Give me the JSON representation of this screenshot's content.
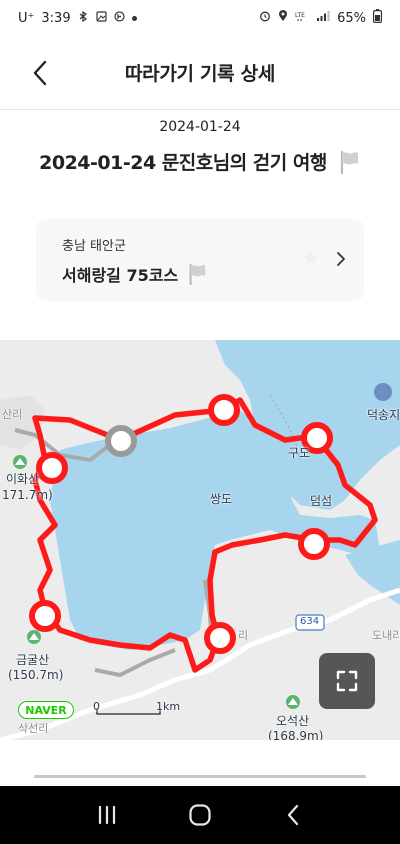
{
  "status_bar": {
    "carrier": "U⁺",
    "time": "3:39",
    "battery": "65%",
    "left_icons": [
      "bluetooth-icon",
      "image-icon",
      "app-icon"
    ],
    "right_icons": [
      "alarm-icon",
      "location-icon",
      "lte-icon",
      "signal-icon",
      "battery-icon"
    ]
  },
  "header": {
    "title": "따라가기 기록 상세"
  },
  "record": {
    "date": "2024-01-24",
    "title": "2024-01-24 문진호님의 걷기 여행"
  },
  "course": {
    "region": "충남 태안군",
    "name": "서해랑길 75코스"
  },
  "map": {
    "labels": {
      "sanri": "산리",
      "ihwasan": "이화산",
      "ihwasan_height": "171.7m)",
      "ssangdo": "쌍도",
      "gudo": "구도",
      "deomseom": "덤섬",
      "deoksong": "덕송지",
      "geumgulsan": "금굴산",
      "geumgulsan_height": "(150.7m)",
      "ri": "리",
      "donae": "도내리",
      "road": "634",
      "oseoksan": "오석산",
      "oseoksan_height": "(168.9m)",
      "sakseonri": "삭선리",
      "scale_zero": "0",
      "scale_km": "1km"
    },
    "logo": "NAVER",
    "colors": {
      "route": "#ff1a1a",
      "water": "#a8d5ee",
      "land": "#ececec"
    }
  },
  "nav": {
    "icons": [
      "recent-apps-icon",
      "home-icon",
      "back-icon"
    ]
  }
}
